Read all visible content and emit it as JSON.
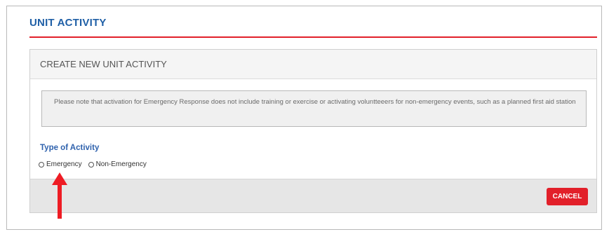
{
  "page": {
    "title": "UNIT ACTIVITY"
  },
  "panel": {
    "title": "CREATE NEW UNIT ACTIVITY",
    "notice": "Please note that activation for Emergency Response does not include training or exercise or activating voluntteeers for non-emergency events, such as a planned first aid station",
    "type_label": "Type of Activity",
    "options": [
      "Emergency",
      "Non-Emergency"
    ],
    "cancel_label": "CANCEL"
  },
  "colors": {
    "brand_blue": "#1f5fa6",
    "accent_red": "#e2202a"
  },
  "annotation": {
    "icon": "up-arrow-icon"
  }
}
